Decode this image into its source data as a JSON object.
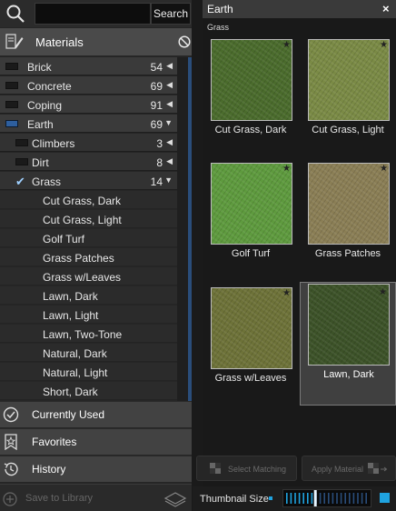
{
  "search": {
    "placeholder": "",
    "value": "",
    "button_label": "Search"
  },
  "materials": {
    "title": "Materials"
  },
  "tree": [
    {
      "label": "Brick",
      "count": "54",
      "arrow": "◀",
      "level": "top",
      "folder": "dark"
    },
    {
      "label": "Concrete",
      "count": "69",
      "arrow": "◀",
      "level": "top",
      "folder": "dark"
    },
    {
      "label": "Coping",
      "count": "91",
      "arrow": "◀",
      "level": "top",
      "folder": "dark"
    },
    {
      "label": "Earth",
      "count": "69",
      "arrow": "▼",
      "level": "top",
      "folder": "blue"
    },
    {
      "label": "Climbers",
      "count": "3",
      "arrow": "◀",
      "level": "sub",
      "folder": "dark"
    },
    {
      "label": "Dirt",
      "count": "8",
      "arrow": "◀",
      "level": "sub",
      "folder": "dark"
    },
    {
      "label": "Grass",
      "count": "14",
      "arrow": "▼",
      "level": "sub",
      "folder": "check"
    },
    {
      "label": "Cut Grass, Dark",
      "level": "leaf"
    },
    {
      "label": "Cut Grass, Light",
      "level": "leaf"
    },
    {
      "label": "Golf Turf",
      "level": "leaf"
    },
    {
      "label": "Grass Patches",
      "level": "leaf"
    },
    {
      "label": "Grass w/Leaves",
      "level": "leaf"
    },
    {
      "label": "Lawn, Dark",
      "level": "leaf"
    },
    {
      "label": "Lawn, Light",
      "level": "leaf"
    },
    {
      "label": "Lawn, Two-Tone",
      "level": "leaf"
    },
    {
      "label": "Natural, Dark",
      "level": "leaf"
    },
    {
      "label": "Natural, Light",
      "level": "leaf"
    },
    {
      "label": "Short, Dark",
      "level": "leaf"
    }
  ],
  "nav": {
    "currently_used": "Currently Used",
    "favorites": "Favorites",
    "history": "History"
  },
  "footer": {
    "save_label": "Save to Library"
  },
  "browser": {
    "title": "Earth",
    "close": "×",
    "category": "Grass",
    "thumbnails": [
      {
        "name": "Cut Grass, Dark",
        "color": "#4a6b2c",
        "selected": false
      },
      {
        "name": "Cut Grass, Light",
        "color": "#7a8a45",
        "selected": false
      },
      {
        "name": "Golf Turf",
        "color": "#5e9a3e",
        "selected": false
      },
      {
        "name": "Grass Patches",
        "color": "#8a7e55",
        "selected": false
      },
      {
        "name": "Grass w/Leaves",
        "color": "#6d7238",
        "selected": false
      },
      {
        "name": "Lawn, Dark",
        "color": "#3c5228",
        "selected": true
      }
    ]
  },
  "actions": {
    "select_matching": "Select Matching",
    "apply_material": "Apply Material"
  },
  "thumbnail_size": {
    "label": "Thumbnail Size",
    "level": 0.35
  },
  "colors": {
    "accent": "#1fa3e0",
    "selection_blue": "#2a4d7a"
  }
}
